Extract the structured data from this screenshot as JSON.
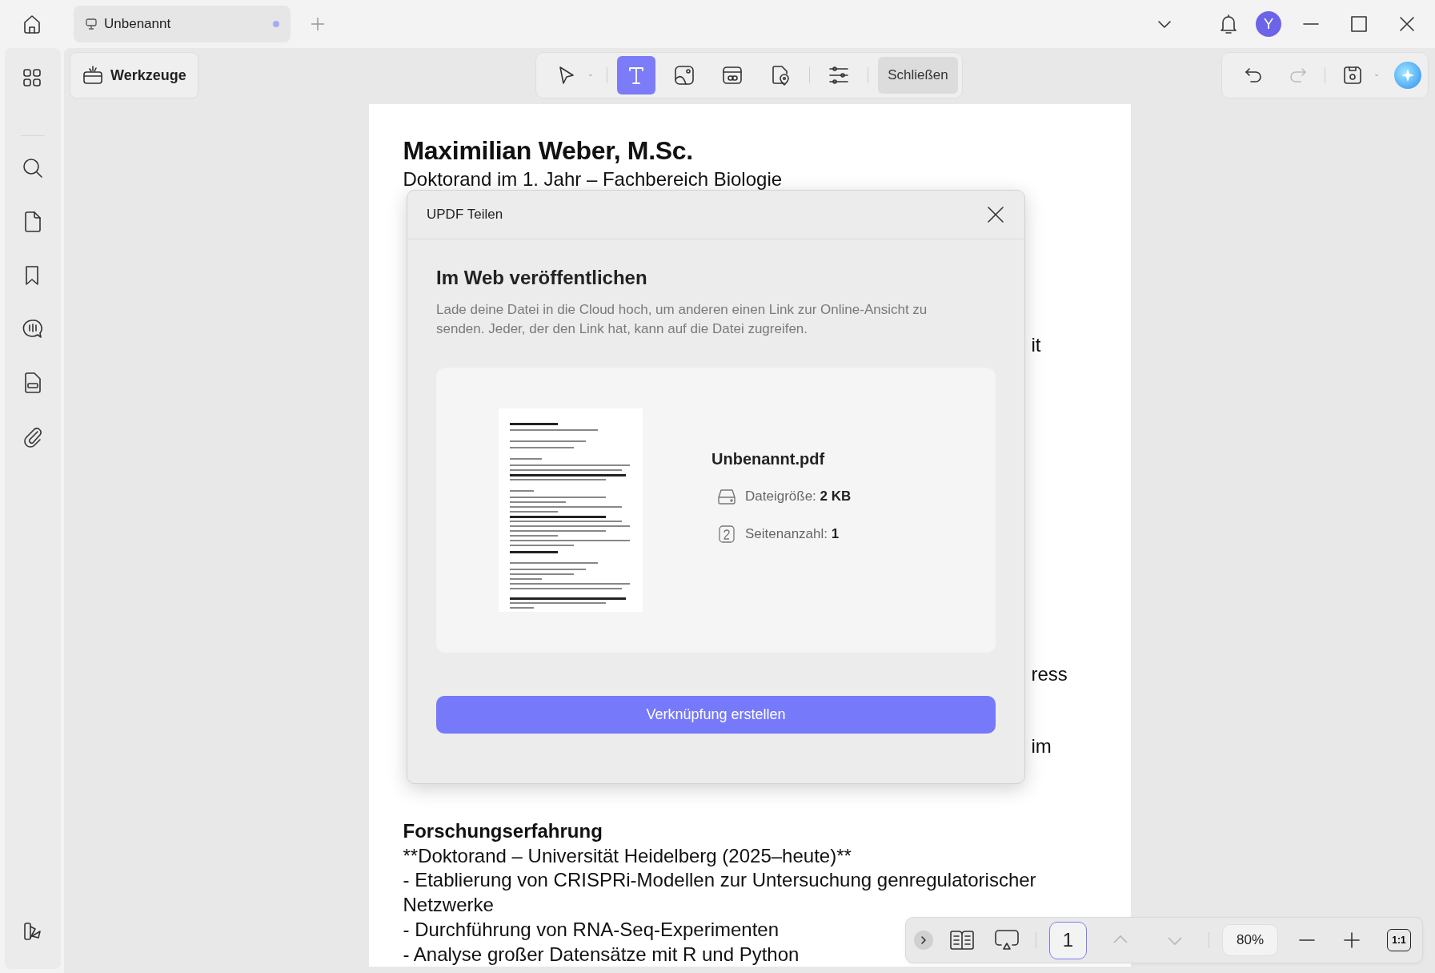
{
  "tab": {
    "title": "Unbenannt",
    "modified": true
  },
  "avatar": {
    "initial": "Y"
  },
  "tools_button": {
    "label": "Werkzeuge"
  },
  "toolbar": {
    "tools": [
      {
        "kind": "select",
        "selected": false
      },
      {
        "kind": "text",
        "selected": true
      },
      {
        "kind": "image",
        "selected": false
      },
      {
        "kind": "link",
        "selected": false
      },
      {
        "kind": "pin",
        "selected": false
      },
      {
        "kind": "settings",
        "selected": false
      }
    ],
    "close_label": "Schließen"
  },
  "history": [
    {
      "kind": "undo",
      "disabled": false
    },
    {
      "kind": "redo",
      "disabled": true
    }
  ],
  "document": {
    "title": "Maximilian Weber, M.Sc.",
    "subtitle": "Doktorand im 1. Jahr – Fachbereich Biologie",
    "covered_fragments": [
      "it",
      "ress",
      "im"
    ],
    "sections": [
      {
        "heading": "Forschungserfahrung",
        "lines": [
          {
            "text": "**Doktorand – Universität Heidelberg (2025–heute)**"
          },
          {
            "text": "- Etablierung von CRISPRi-Modellen zur Untersuchung genregulatorischer"
          },
          {
            "text": "Netzwerke"
          },
          {
            "text": "- Durchführung von RNA-Seq-Experimenten"
          },
          {
            "text": "- Analyse großer Datensätze mit R und Python"
          }
        ]
      }
    ]
  },
  "dialog": {
    "title": "UPDF Teilen",
    "heading": "Im Web veröffentlichen",
    "description": "Lade deine Datei in die Cloud hoch, um anderen einen Link zur Online-Ansicht zu senden. Jeder, der den Link hat, kann auf die Datei zugreifen.",
    "file": {
      "name": "Unbenannt.pdf",
      "size": "Dateigröße: **2 KB**",
      "pages": "Seitenanzahl: **1**"
    },
    "button": "Verknüpfung erstellen"
  },
  "pager": {
    "page": "1",
    "zoom": "80%",
    "actual_size": "1:1",
    "nav": [
      {
        "kind": "up",
        "disabled": true
      },
      {
        "kind": "down",
        "disabled": true
      }
    ]
  }
}
